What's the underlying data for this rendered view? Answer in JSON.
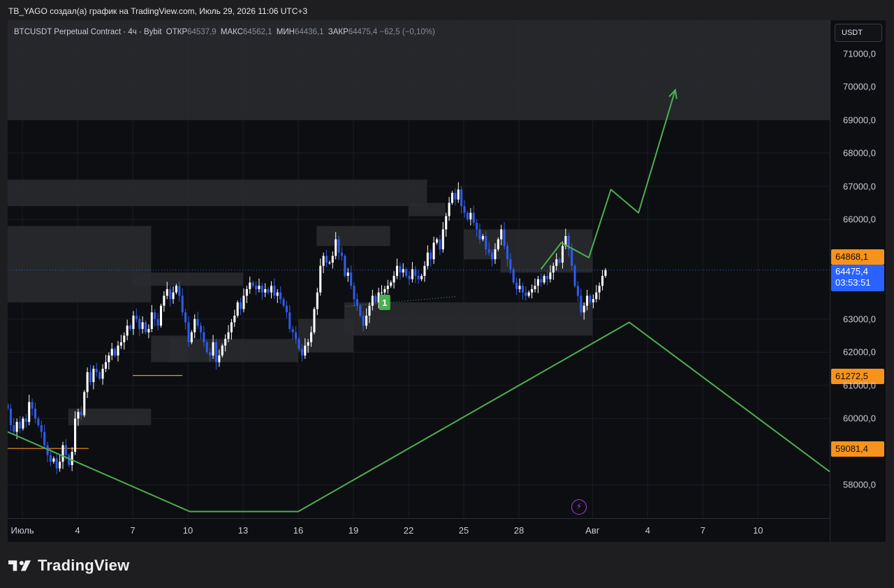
{
  "header": {
    "caption": "TB_YAGO создал(а) график на TradingView.com, Июль 29, 2026 11:06 UTC+3"
  },
  "legend": {
    "symbol": "BTCUSDT Perpetual Contract · 4ч · Bybit",
    "open_label": "ОТКР",
    "open_value": "64537,9",
    "high_label": "МАКС",
    "high_value": "64562,1",
    "low_label": "МИН",
    "low_value": "64436,1",
    "close_label": "ЗАКР",
    "close_value": "64475,4",
    "change": "−62,5 (−0,10%)"
  },
  "price_axis": {
    "currency": "USDT",
    "tag_upper": "64868,1",
    "tag_current": "64475,4",
    "tag_countdown": "03:53:51",
    "tag_mid": "61272,5",
    "tag_low": "59081,4"
  },
  "branding": {
    "logo_text": "TradingView"
  },
  "colors": {
    "background": "#0d0e12",
    "candle_up": "#ffffff",
    "candle_down": "#2f5bea",
    "projection": "#4caf50",
    "zone": "#2a2b30",
    "price_tag_orange": "#f7931a",
    "price_tag_blue": "#2962ff",
    "alert_icon": "#a641d6"
  },
  "chart_data": {
    "type": "candlestick",
    "symbol": "BTCUSDT",
    "timeframe": "4ч",
    "ylim": [
      57000,
      72000
    ],
    "y_ticks": [
      {
        "value": 58000,
        "label": "58000,0"
      },
      {
        "value": 60000,
        "label": "60000,0"
      },
      {
        "value": 61000,
        "label": "61000,0"
      },
      {
        "value": 62000,
        "label": "62000,0"
      },
      {
        "value": 63000,
        "label": "63000,0"
      },
      {
        "value": 66000,
        "label": "66000,0"
      },
      {
        "value": 67000,
        "label": "67000,0"
      },
      {
        "value": 68000,
        "label": "68000,0"
      },
      {
        "value": 69000,
        "label": "69000,0"
      },
      {
        "value": 70000,
        "label": "70000,0"
      },
      {
        "value": 71000,
        "label": "71000,0"
      }
    ],
    "x_ticks": [
      {
        "day": 1,
        "label": "Июль"
      },
      {
        "day": 4,
        "label": "4"
      },
      {
        "day": 7,
        "label": "7"
      },
      {
        "day": 10,
        "label": "10"
      },
      {
        "day": 13,
        "label": "13"
      },
      {
        "day": 16,
        "label": "16"
      },
      {
        "day": 19,
        "label": "19"
      },
      {
        "day": 22,
        "label": "22"
      },
      {
        "day": 25,
        "label": "25"
      },
      {
        "day": 28,
        "label": "28"
      },
      {
        "day": 32,
        "label": "Авг"
      },
      {
        "day": 35,
        "label": "4"
      },
      {
        "day": 38,
        "label": "7"
      },
      {
        "day": 41,
        "label": "10"
      }
    ],
    "x_domain": [
      0.2,
      44.9
    ],
    "candles_start_day": 0.2,
    "candle_step_days": 0.1667,
    "closes": [
      60300,
      59800,
      59600,
      59900,
      59700,
      60000,
      59900,
      60500,
      60300,
      60000,
      59800,
      59600,
      59200,
      58900,
      58700,
      58800,
      58500,
      58700,
      59200,
      58900,
      58600,
      59000,
      60000,
      60200,
      60100,
      60800,
      61400,
      61100,
      61500,
      61400,
      61200,
      61500,
      61700,
      61900,
      62100,
      61900,
      62200,
      62300,
      62500,
      62800,
      62700,
      63100,
      63000,
      62700,
      62900,
      62600,
      62700,
      63200,
      63000,
      62800,
      63400,
      63700,
      63900,
      63600,
      63800,
      64000,
      63700,
      63200,
      62900,
      62300,
      62600,
      63000,
      62800,
      62600,
      62300,
      62000,
      61900,
      62300,
      61700,
      61900,
      62200,
      62400,
      62600,
      62900,
      63100,
      63500,
      63300,
      63700,
      63900,
      64100,
      64000,
      63900,
      64000,
      63800,
      63900,
      63800,
      64000,
      63700,
      63800,
      63600,
      63400,
      63200,
      62700,
      62600,
      62400,
      62100,
      61900,
      62200,
      62300,
      62600,
      63300,
      63800,
      64600,
      64900,
      64700,
      64700,
      64900,
      65400,
      65000,
      64900,
      64300,
      64400,
      64000,
      63600,
      63400,
      63100,
      62800,
      63100,
      63400,
      63700,
      63500,
      63800,
      63800,
      63900,
      64000,
      64100,
      64300,
      64600,
      64400,
      64500,
      64300,
      64200,
      64500,
      64300,
      64200,
      64300,
      64600,
      65000,
      64800,
      65300,
      65400,
      65100,
      65700,
      66100,
      66500,
      66800,
      66600,
      66900,
      66400,
      66200,
      66000,
      66200,
      65900,
      65700,
      65400,
      65500,
      65100,
      65000,
      64800,
      65100,
      65400,
      65700,
      65200,
      64800,
      64500,
      64100,
      63900,
      64000,
      63800,
      63700,
      63800,
      63900,
      64000,
      64200,
      64100,
      64300,
      64200,
      64400,
      64600,
      64800,
      64700,
      65200,
      65500,
      65100,
      64600,
      64000,
      63700,
      63200,
      63400,
      63700,
      63500,
      63600,
      63800,
      64000,
      64300,
      64475
    ],
    "zones": [
      {
        "x0": 0.2,
        "x1": 23.0,
        "y0": 66400,
        "y1": 67200
      },
      {
        "x0": 0.2,
        "x1": 8.0,
        "y0": 63500,
        "y1": 65800
      },
      {
        "x0": 7.0,
        "x1": 13.0,
        "y0": 64000,
        "y1": 64400
      },
      {
        "x0": 3.5,
        "x1": 8.0,
        "y0": 59800,
        "y1": 60300
      },
      {
        "x0": 8.0,
        "x1": 10.0,
        "y0": 61700,
        "y1": 62500
      },
      {
        "x0": 9.0,
        "x1": 16.0,
        "y0": 61700,
        "y1": 62400
      },
      {
        "x0": 16.0,
        "x1": 19.0,
        "y0": 62000,
        "y1": 63000
      },
      {
        "x0": 17.0,
        "x1": 21.0,
        "y0": 65200,
        "y1": 65800
      },
      {
        "x0": 22.0,
        "x1": 24.0,
        "y0": 66100,
        "y1": 66500
      },
      {
        "x0": 25.0,
        "x1": 27.0,
        "y0": 64800,
        "y1": 65700
      },
      {
        "x0": 27.0,
        "x1": 32.0,
        "y0": 64400,
        "y1": 65700
      },
      {
        "x0": 18.5,
        "x1": 32.0,
        "y0": 62500,
        "y1": 63500
      },
      {
        "x0": 0.2,
        "x1": 44.9,
        "y0": 69000,
        "y1": 72000
      }
    ],
    "level_lines": [
      {
        "x0": 7.0,
        "x1": 9.7,
        "y": 61300,
        "color": "#f7931a"
      },
      {
        "x0": 0.2,
        "x1": 4.6,
        "y": 59100,
        "color": "#f7931a"
      }
    ],
    "projection_up": [
      [
        29.2,
        64500
      ],
      [
        30.3,
        65300
      ],
      [
        31.8,
        64850
      ],
      [
        33.0,
        66900
      ],
      [
        34.5,
        66200
      ],
      [
        36.5,
        69900
      ]
    ],
    "projection_long_line": [
      [
        0.2,
        59600
      ],
      [
        10.1,
        57200
      ],
      [
        16.0,
        57200
      ],
      [
        34.0,
        62900
      ],
      [
        44.9,
        58400
      ]
    ],
    "current_price": 64475.4,
    "marker_label": "1"
  }
}
